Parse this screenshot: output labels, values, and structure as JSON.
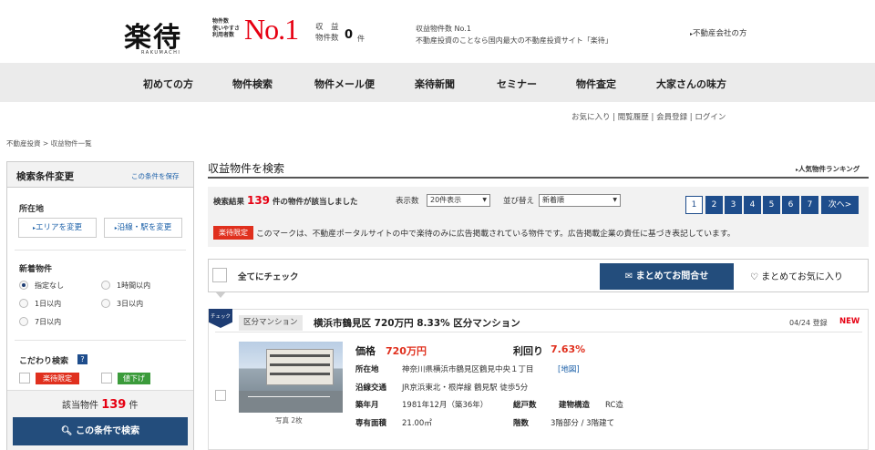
{
  "header": {
    "logo_text": "楽待",
    "logo_sub": "RAKUMACHI",
    "stat_labels": [
      "物件数",
      "使いやすさ",
      "利用者数"
    ],
    "no1": "No.1",
    "shueki": "収　益",
    "bukken_count_label": "物件数",
    "bukken_count": "0",
    "bukken_unit": "件",
    "tagline1": "収益物件数 No.1",
    "tagline2": "不動産投資のことなら国内最大の不動産投資サイト「楽待」",
    "realtor_link": "不動産会社の方"
  },
  "nav": [
    "初めての方",
    "物件検索",
    "物件メール便",
    "楽待新聞",
    "セミナー",
    "物件査定",
    "大家さんの味方"
  ],
  "sublinks": {
    "fav": "お気に入り",
    "history": "閲覧履歴",
    "register": "会員登録",
    "login": "ログイン"
  },
  "breadcrumb": {
    "home": "不動産投資",
    "sep": ">",
    "current": "収益物件一覧"
  },
  "sidebar": {
    "title": "検索条件変更",
    "save": "この条件を保存",
    "location_label": "所在地",
    "area_btn": "エリアを変更",
    "line_btn": "沿線・駅を変更",
    "new_label": "新着物件",
    "radio": [
      "指定なし",
      "1時間以内",
      "1日以内",
      "3日以内",
      "7日以内"
    ],
    "kodawari": "こだわり検索",
    "help": "?",
    "tag_limited": "楽待限定",
    "tag_discount": "値下げ",
    "count_label": "該当物件",
    "count": "139",
    "count_unit": "件",
    "search_btn": "この条件で検索"
  },
  "main": {
    "title": "収益物件を検索",
    "ranking": "人気物件ランキング",
    "result_prefix": "検索結果",
    "result_count": "139",
    "result_suffix": "件の物件が該当しました",
    "display_label": "表示数",
    "display_value": "20件表示",
    "sort_label": "並び替え",
    "sort_value": "新着順",
    "pages": [
      "1",
      "2",
      "3",
      "4",
      "5",
      "6",
      "7"
    ],
    "next": "次へ>",
    "notice_tag": "楽待限定",
    "notice_text": "このマークは、不動産ポータルサイトの中で楽待のみに広告掲載されている物件です。広告掲載企業の責任に基づき表記しています。",
    "check_all": "全てにチェック",
    "inquiry_btn": "まとめてお問合せ",
    "fav_btn": "まとめてお気に入り"
  },
  "listing": {
    "check_badge": "チェック",
    "type_tag": "区分マンション",
    "title": "横浜市鶴見区 720万円 8.33% 区分マンション",
    "date": "04/24 登録",
    "new": "NEW",
    "photo_caption": "写真 2枚",
    "price_label": "価格",
    "price": "720万円",
    "yield_label": "利回り",
    "yield": "7.63%",
    "location_label": "所在地",
    "location": "神奈川県横浜市鶴見区鶴見中央１丁目",
    "map": "[地図]",
    "access_label": "沿線交通",
    "access": "JR京浜東北・根岸線 鶴見駅 徒歩5分",
    "built_label": "築年月",
    "built": "1981年12月（築36年）",
    "units_label": "総戸数",
    "structure_label": "建物構造",
    "structure": "RC造",
    "area_label": "専有面積",
    "area": "21.00㎡",
    "floor_label": "階数",
    "floor": "3階部分 / 3階建て"
  }
}
